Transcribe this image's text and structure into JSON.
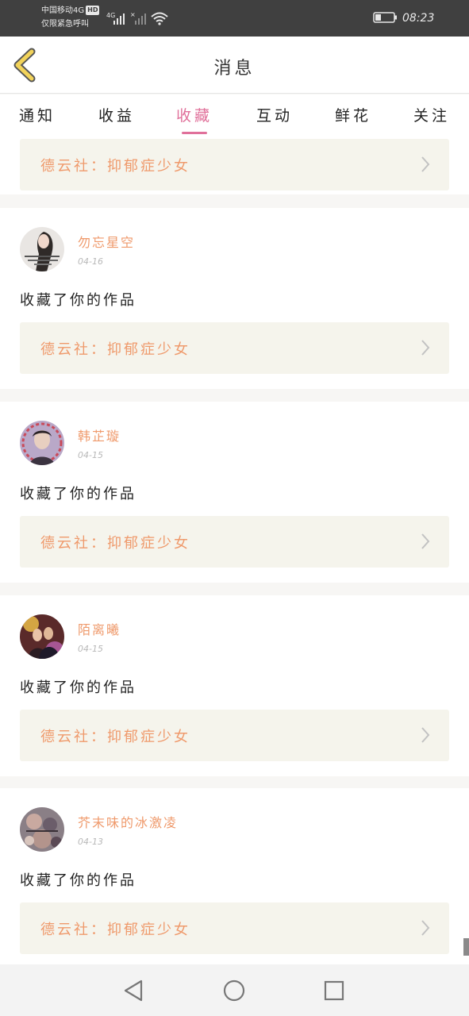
{
  "status_bar": {
    "carrier_line1": "中国移动4G",
    "hd_badge": "HD",
    "carrier_line2": "仅限紧急呼叫",
    "network1": "4G",
    "time": "08:23"
  },
  "header": {
    "title": "消息",
    "back_icon": "chevron-left-icon"
  },
  "tabs": [
    {
      "label": "通知",
      "active": false
    },
    {
      "label": "收益",
      "active": false
    },
    {
      "label": "收藏",
      "active": true
    },
    {
      "label": "互动",
      "active": false
    },
    {
      "label": "鲜花",
      "active": false
    },
    {
      "label": "关注",
      "active": false
    }
  ],
  "colors": {
    "accent": "#e0709a",
    "username": "#ef9a6c",
    "work_bg": "#f5f4ec"
  },
  "partial_top_work": "德云社：抑郁症少女",
  "notifications": [
    {
      "username": "勿忘星空",
      "date": "04-16",
      "action": "收藏了你的作品",
      "work": "德云社：抑郁症少女"
    },
    {
      "username": "韩芷璇",
      "date": "04-15",
      "action": "收藏了你的作品",
      "work": "德云社：抑郁症少女"
    },
    {
      "username": "陌离曦",
      "date": "04-15",
      "action": "收藏了你的作品",
      "work": "德云社：抑郁症少女"
    },
    {
      "username": "芥末味的冰激凌",
      "date": "04-13",
      "action": "收藏了你的作品",
      "work": "德云社：抑郁症少女"
    }
  ],
  "navbar": {
    "back_icon": "triangle-back-icon",
    "home_icon": "circle-home-icon",
    "recents_icon": "square-recents-icon"
  }
}
